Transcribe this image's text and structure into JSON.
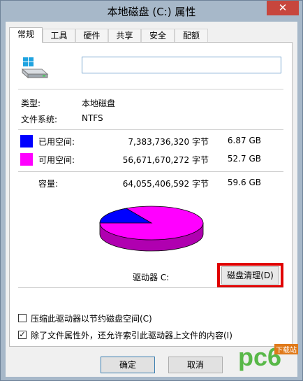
{
  "window": {
    "title": "本地磁盘 (C:) 属性",
    "close_glyph": "✕"
  },
  "tabs": [
    {
      "label": "常规",
      "active": true
    },
    {
      "label": "工具",
      "active": false
    },
    {
      "label": "硬件",
      "active": false
    },
    {
      "label": "共享",
      "active": false
    },
    {
      "label": "安全",
      "active": false
    },
    {
      "label": "配额",
      "active": false
    }
  ],
  "general": {
    "drive_icon": "hard-drive-icon",
    "name_value": "",
    "type_label": "类型:",
    "type_value": "本地磁盘",
    "fs_label": "文件系统:",
    "fs_value": "NTFS",
    "used": {
      "label": "已用空间:",
      "bytes": "7,383,736,320 字节",
      "size": "6.87 GB",
      "color": "#0000ff"
    },
    "free": {
      "label": "可用空间:",
      "bytes": "56,671,670,272 字节",
      "size": "52.7 GB",
      "color": "#ff00ff"
    },
    "capacity": {
      "label": "容量:",
      "bytes": "64,055,406,592 字节",
      "size": "59.6 GB"
    },
    "drive_label": "驱动器 C:",
    "cleanup_button": "磁盘清理(D)",
    "compress_option": {
      "label": "压缩此驱动器以节约磁盘空间(C)",
      "checked": false
    },
    "index_option": {
      "label": "除了文件属性外，还允许索引此驱动器上文件的内容(I)",
      "checked": true
    }
  },
  "buttons": {
    "ok": "确定",
    "cancel": "取消"
  },
  "watermark": {
    "text": "pc6",
    "sub": "下载站"
  }
}
